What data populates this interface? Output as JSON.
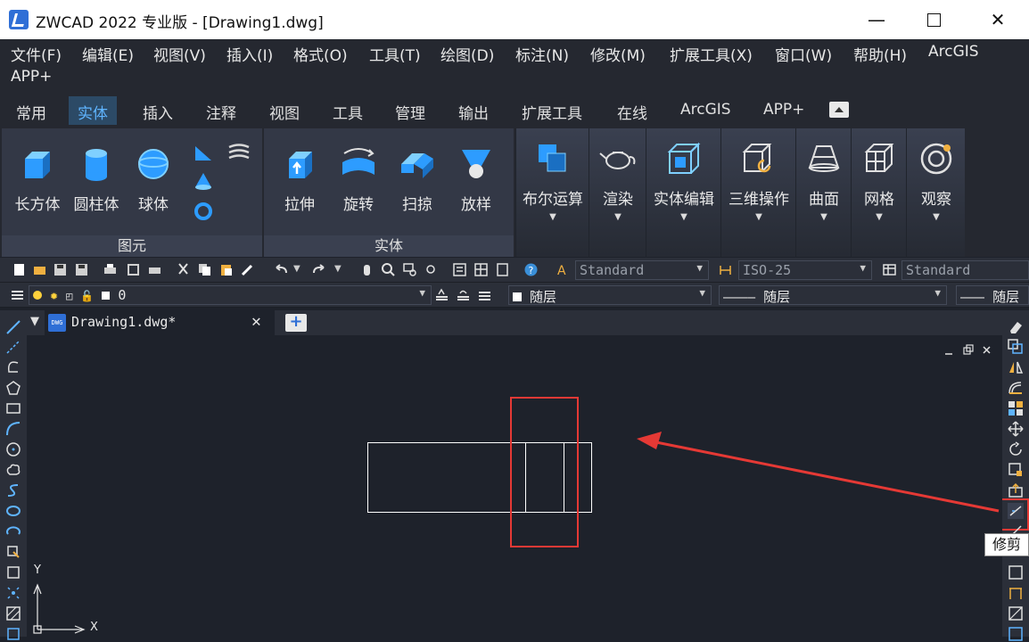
{
  "window": {
    "title": "ZWCAD 2022 专业版 - [Drawing1.dwg]"
  },
  "menu": [
    "文件(F)",
    "编辑(E)",
    "视图(V)",
    "插入(I)",
    "格式(O)",
    "工具(T)",
    "绘图(D)",
    "标注(N)",
    "修改(M)",
    "扩展工具(X)",
    "窗口(W)",
    "帮助(H)",
    "ArcGIS",
    "APP+"
  ],
  "ribbon_tabs": [
    "常用",
    "实体",
    "插入",
    "注释",
    "视图",
    "工具",
    "管理",
    "输出",
    "扩展工具",
    "在线",
    "ArcGIS",
    "APP+"
  ],
  "active_tab": "实体",
  "ribbon": {
    "primitives": {
      "title": "图元",
      "box": "长方体",
      "cylinder": "圆柱体",
      "sphere": "球体"
    },
    "solid": {
      "title": "实体",
      "extrude": "拉伸",
      "revolve": "旋转",
      "sweep": "扫掠",
      "loft": "放样"
    },
    "boolean": "布尔运算",
    "render": "渲染",
    "solid_edit": "实体编辑",
    "op3d": "三维操作",
    "surface": "曲面",
    "mesh": "网格",
    "view": "观察"
  },
  "toolbar": {
    "text_style": "Standard",
    "dim_style": "ISO-25",
    "table_style": "Standard",
    "layer": "0",
    "color": "随层",
    "linetype": "———— 随层",
    "lineweight": "——— 随层"
  },
  "document": {
    "tab": "Drawing1.dwg*"
  },
  "canvas": {
    "x_axis": "X",
    "y_axis": "Y"
  },
  "tooltip": "修剪",
  "colors": {
    "highlight": "#e53935",
    "accent": "#5fb4ff"
  }
}
